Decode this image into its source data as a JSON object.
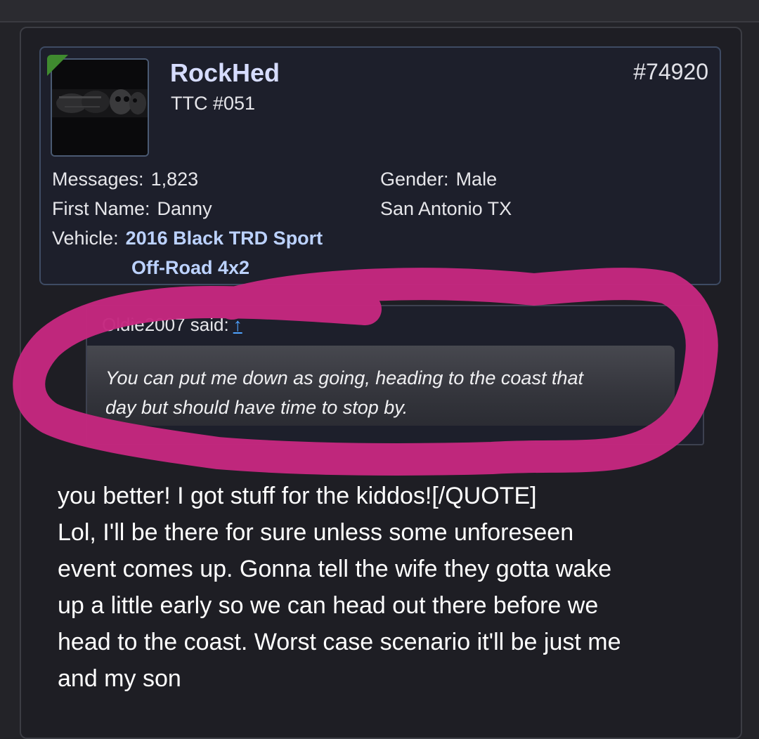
{
  "user": {
    "username": "RockHed",
    "title": "TTC #051",
    "online": true
  },
  "post": {
    "number": "#74920"
  },
  "stats": {
    "messages_label": "Messages:",
    "messages_value": "1,823",
    "first_name_label": "First Name:",
    "first_name_value": "Danny",
    "vehicle_label": "Vehicle:",
    "vehicle_value_line1": "2016 Black TRD Sport",
    "vehicle_value_line2": "Off-Road 4x2",
    "gender_label": "Gender:",
    "gender_value": "Male",
    "location": "San Antonio TX"
  },
  "quote": {
    "author_said": "Oldie2007 said:",
    "jump_icon": "↑",
    "text_line1": "You can put me down as going, heading to the coast that",
    "text_line2": "day but should have time to stop by."
  },
  "message": {
    "lines": [
      "you better! I got stuff for the kiddos![/QUOTE]",
      "Lol, I'll be there for sure unless some unforeseen",
      "event comes up. Gonna tell the wife they gotta wake",
      "up a little early so we can head out there before we",
      "head to the coast. Worst case scenario it'll be just me",
      "and my son"
    ]
  },
  "colors": {
    "username": "#d6dcff",
    "link": "#bcd2ff",
    "marker": "#c4277f",
    "online": "#3f8a2f"
  }
}
